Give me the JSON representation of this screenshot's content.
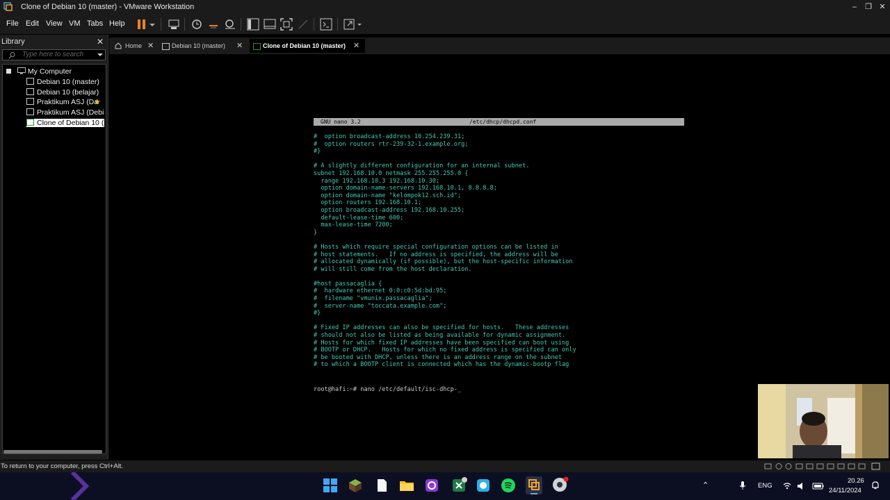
{
  "window": {
    "title": "Clone of Debian 10 (master) - VMware Workstation",
    "controls": {
      "minimize": "–",
      "maximize": "❐",
      "close": "✕"
    }
  },
  "menu": [
    "File",
    "Edit",
    "View",
    "VM",
    "Tabs",
    "Help"
  ],
  "toolbar": {
    "icons": [
      "pause-icon",
      "dropdown-icon",
      "send-ctrl-alt-del-icon",
      "snapshot-icon",
      "revert-snapshot-icon",
      "snapshot-manager-icon",
      "library-view-icon",
      "thumbnail-view-icon",
      "fullscreen-icon",
      "unity-icon",
      "console-icon",
      "stretch-icon"
    ],
    "pause_color": "#e8822d"
  },
  "library": {
    "header": "Library",
    "close": "✕",
    "search_placeholder": "Type here to search",
    "tree": {
      "root": "My Computer",
      "items": [
        "Debian 10 (master)",
        "Debian 10 (belajar)",
        "Praktikum ASJ (Da",
        "Praktikum ASJ (Debian",
        "Clone of Debian 10 (m"
      ]
    }
  },
  "tabs": [
    {
      "label": "Home",
      "close": "✕",
      "icon": "home-icon"
    },
    {
      "label": "Debian 10 (master)",
      "close": "✕",
      "icon": "vm-icon"
    },
    {
      "label": "Clone of Debian 10 (master)",
      "close": "✕",
      "icon": "vm-running-icon"
    }
  ],
  "console": {
    "nano_version": "GNU nano 3.2",
    "filename": "/etc/dhcp/dhcpd.conf",
    "lines": [
      "#  option broadcast-address 10.254.239.31;",
      "#  option routers rtr-239-32-1.example.org;",
      "#}",
      "",
      "# A slightly different configuration for an internal subnet.",
      "subnet 192.168.10.0 netmask 255.255.255.0 {",
      "  range 192.168.10.3 192.168.10.30;",
      "  option domain-name-servers 192.168.10.1, 8.8.8.8;",
      "  option domain-name \"kelompok12.sch.id\";",
      "  option routers 192.168.10.1;",
      "  option broadcast-address 192.168.10.255;",
      "  default-lease-time 600;",
      "  max-lease-time 7200;",
      "}",
      "",
      "# Hosts which require special configuration options can be listed in",
      "# host statements.   If no address is specified, the address will be",
      "# allocated dynamically (if possible), but the host-specific information",
      "# will still come from the host declaration.",
      "",
      "#host passacaglia {",
      "#  hardware ethernet 0:0:c0:5d:bd:95;",
      "#  filename \"vmunix.passacaglia\";",
      "#  server-name \"toccata.example.com\";",
      "#}",
      "",
      "# Fixed IP addresses can also be specified for hosts.   These addresses",
      "# should not also be listed as being available for dynamic assignment.",
      "# Hosts for which fixed IP addresses have been specified can boot using",
      "# BOOTP or DHCP.   Hosts for which no fixed address is specified can only",
      "# be booted with DHCP, unless there is an address range on the subnet",
      "# to which a BOOTP client is connected which has the dynamic-bootp flag"
    ],
    "prompt": "root@hafi:~# nano /etc/default/isc-dhcp-_"
  },
  "statusbar": {
    "message": "To return to your computer, press Ctrl+Alt."
  },
  "taskbar": {
    "apps": [
      "windows-start-icon",
      "minecraft-icon",
      "notepad-icon",
      "file-explorer-icon",
      "app-icon",
      "excel-icon",
      "app-icon-2",
      "spotify-icon",
      "vmware-icon",
      "chrome-icon"
    ],
    "tray": {
      "language": "ENG",
      "time": "20.26",
      "date": "24/11/2024",
      "chevron": "⌃"
    }
  }
}
